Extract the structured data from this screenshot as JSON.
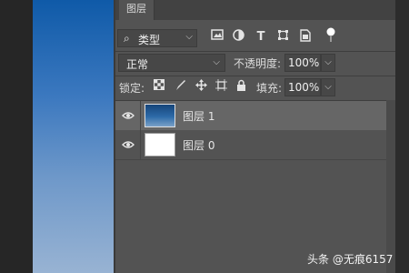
{
  "panel": {
    "tab_title": "图层"
  },
  "filter": {
    "icon": "search-icon",
    "label": "类型",
    "icons": [
      "image-filter-icon",
      "adjustment-filter-icon",
      "type-filter-icon",
      "shape-filter-icon",
      "smart-object-filter-icon",
      "filter-toggle-icon"
    ]
  },
  "blend": {
    "mode": "正常",
    "opacity_label": "不透明度:",
    "opacity_value": "100%"
  },
  "lock": {
    "label": "锁定:",
    "fill_label": "填充:",
    "fill_value": "100%"
  },
  "layers": [
    {
      "name": "图层 1",
      "visible": true,
      "selected": true,
      "thumb": "blue-image"
    },
    {
      "name": "图层 0",
      "visible": true,
      "selected": false,
      "thumb": "white"
    }
  ],
  "watermark": "头条 @无痕6157"
}
